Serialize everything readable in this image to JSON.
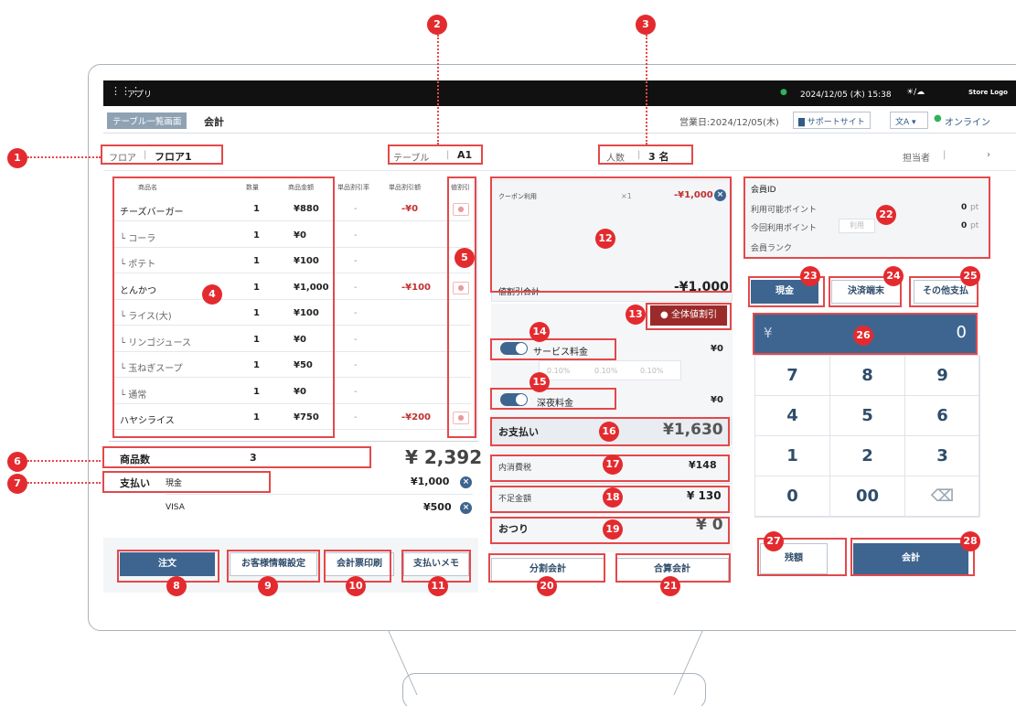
{
  "app": {
    "menu_label": "アプリ",
    "datetime": "2024/12/05 (木) 15:38",
    "weather": "☀/☁",
    "logo": "Store Logo"
  },
  "header": {
    "back_tab": "テーブル一覧画面",
    "title": "会計",
    "business_date": "営業日:2024/12/05(木)",
    "support": "サポートサイト",
    "lang": "文A",
    "online": "オンライン"
  },
  "info": {
    "floor_label": "フロア",
    "floor_value": "フロア1",
    "table_label": "テーブル",
    "table_value": "A1",
    "people_label": "人数",
    "people_value": "3 名",
    "staff_label": "担当者",
    "staff_value": "|"
  },
  "order_table": {
    "headers": [
      "商品名",
      "数量",
      "商品金額",
      "単品割引率",
      "単品割引額",
      "値割引"
    ],
    "rows": [
      {
        "name": "チーズバーガー",
        "qty": "1",
        "price": "¥880",
        "rate": "-",
        "disc": "-¥0"
      },
      {
        "name": "└ コーラ",
        "qty": "1",
        "price": "¥0",
        "rate": "-",
        "disc": ""
      },
      {
        "name": "└ ポテト",
        "qty": "1",
        "price": "¥100",
        "rate": "-",
        "disc": ""
      },
      {
        "name": "とんかつ",
        "qty": "1",
        "price": "¥1,000",
        "rate": "-",
        "disc": "-¥100"
      },
      {
        "name": "└ ライス(大)",
        "qty": "1",
        "price": "¥100",
        "rate": "-",
        "disc": ""
      },
      {
        "name": "└ リンゴジュース",
        "qty": "1",
        "price": "¥0",
        "rate": "-",
        "disc": ""
      },
      {
        "name": "└ 玉ねぎスープ",
        "qty": "1",
        "price": "¥50",
        "rate": "-",
        "disc": ""
      },
      {
        "name": "└ 通常",
        "qty": "1",
        "price": "¥0",
        "rate": "-",
        "disc": ""
      },
      {
        "name": "ハヤシライス",
        "qty": "1",
        "price": "¥750",
        "rate": "-",
        "disc": "-¥200"
      }
    ]
  },
  "summary": {
    "item_count_label": "商品数",
    "item_count": "3",
    "total": "¥ 2,392",
    "pay_label": "支払い",
    "pay1_method": "現金",
    "pay1_amount": "¥1,000",
    "pay2_method": "VISA",
    "pay2_amount": "¥500"
  },
  "bottom_buttons": {
    "order": "注文",
    "customer": "お客様情報設定",
    "receipt": "会計票印刷",
    "memo": "支払いメモ",
    "split": "分割会計",
    "combine": "合算会計"
  },
  "coupon": {
    "label": "クーポン利用",
    "qty": "×1",
    "amount": "-¥1,000",
    "subtotal_label": "値割引合計",
    "subtotal": "-¥1,000",
    "all_discount": "全体値割引"
  },
  "charges": {
    "service_label": "サービス料金",
    "service_value": "¥0",
    "rates": [
      "0.10%",
      "0.10%",
      "0.10%"
    ],
    "night_label": "深夜料金",
    "night_value": "¥0"
  },
  "totals": {
    "pay_label": "お支払い",
    "pay_value": "¥1,630",
    "tax_label": "内消費税",
    "tax_value": "¥148",
    "short_label": "不足金額",
    "short_value": "¥ 130",
    "change_label": "おつり",
    "change_value": "¥ 0"
  },
  "member": {
    "id_label": "会員ID",
    "points_label": "利用可能ポイント",
    "points_value": "0",
    "points_unit": "pt",
    "use_label": "今回利用ポイント",
    "use_btn": "利用",
    "use_value": "0",
    "use_unit": "pt",
    "rank_label": "会員ランク"
  },
  "payment": {
    "cash": "現金",
    "terminal": "決済端末",
    "other": "その他支払",
    "yen": "¥",
    "input_value": "0"
  },
  "keypad": [
    "7",
    "8",
    "9",
    "4",
    "5",
    "6",
    "1",
    "2",
    "3",
    "0",
    "00",
    "⌫"
  ],
  "actions": {
    "balance": "残額",
    "checkout": "会計"
  },
  "markers": [
    "1",
    "2",
    "3",
    "4",
    "5",
    "6",
    "7",
    "8",
    "9",
    "10",
    "11",
    "12",
    "13",
    "14",
    "15",
    "16",
    "17",
    "18",
    "19",
    "20",
    "21",
    "22",
    "23",
    "24",
    "25",
    "26",
    "27",
    "28"
  ],
  "colors": {
    "marker": "#e32b2f",
    "primary": "#3e6590",
    "online": "#2fb35a"
  }
}
